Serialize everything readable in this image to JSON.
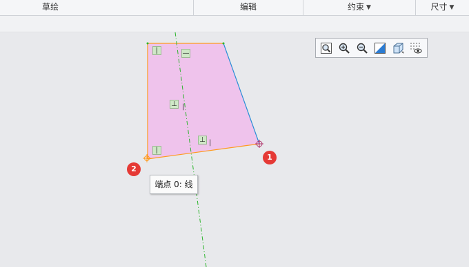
{
  "menu": {
    "sketch": "草绘",
    "edit": "编辑",
    "constrain": "约束",
    "dimension": "尺寸"
  },
  "toolbar": {
    "tools": [
      "refit-icon",
      "zoom-in-icon",
      "zoom-out-icon",
      "display-style-icon",
      "saved-view-icon",
      "sketcher-display-icon"
    ]
  },
  "constraints": {
    "vertical": "|",
    "horizontal": "—",
    "perpendicular": "⊥",
    "tick": "|"
  },
  "badges": {
    "one": "1",
    "two": "2"
  },
  "tooltip": {
    "text": "端点 0: 线"
  },
  "colors": {
    "fill": "#efc3ec",
    "edge_orange": "#ff9a1e",
    "edge_blue": "#2a8fd6",
    "centerline": "#2cb52c",
    "badge": "#e53935",
    "constraint_bg": "#cfe8c7"
  }
}
